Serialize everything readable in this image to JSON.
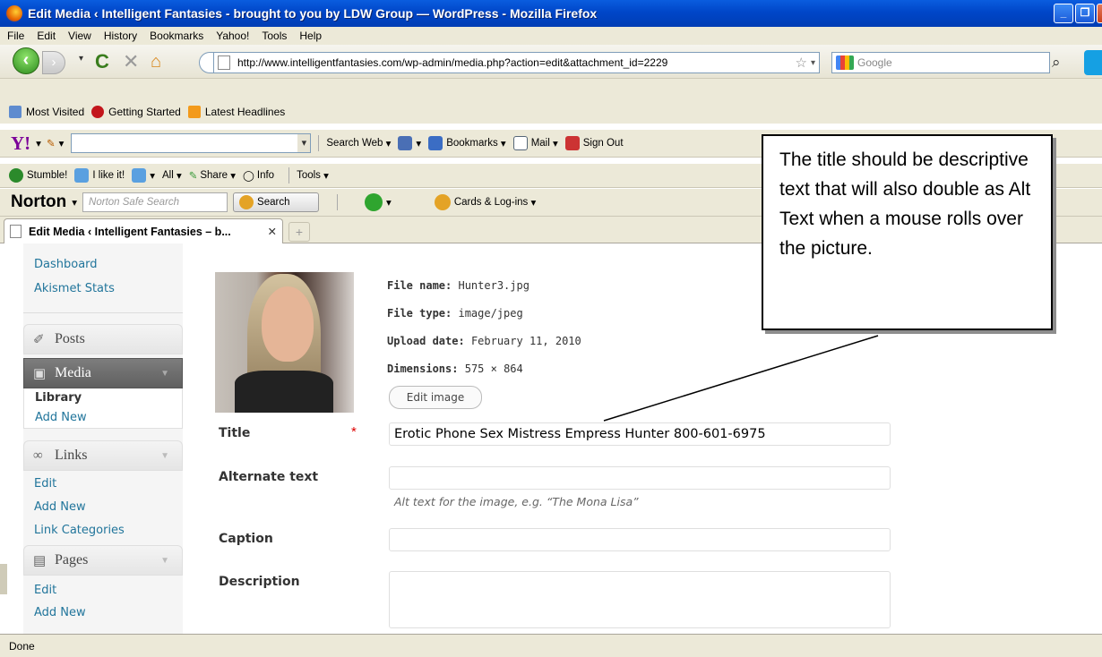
{
  "window": {
    "title": "Edit Media ‹ Intelligent Fantasies - brought to you by LDW Group — WordPress - Mozilla Firefox"
  },
  "menubar": [
    "File",
    "Edit",
    "View",
    "History",
    "Bookmarks",
    "Yahoo!",
    "Tools",
    "Help"
  ],
  "navbar": {
    "url": "http://www.intelligentfantasies.com/wp-admin/media.php?action=edit&attachment_id=2229",
    "search_placeholder": "Google"
  },
  "bookmarks": [
    "Most Visited",
    "Getting Started",
    "Latest Headlines"
  ],
  "yahoo_toolbar": {
    "logo": "Y!",
    "search_web": "Search Web",
    "bookmarks": "Bookmarks",
    "mail": "Mail",
    "sign_out": "Sign Out"
  },
  "stumble_toolbar": {
    "stumble": "Stumble!",
    "like": "I like it!",
    "all": "All",
    "share": "Share",
    "info": "Info",
    "tools": "Tools"
  },
  "norton_toolbar": {
    "logo": "Norton",
    "search_placeholder": "Norton Safe Search",
    "search_button": "Search",
    "cards": "Cards & Log-ins"
  },
  "tab": {
    "label": "Edit Media ‹ Intelligent Fantasies – b..."
  },
  "sidebar": {
    "top_links": [
      "Dashboard",
      "Akismet Stats"
    ],
    "posts": "Posts",
    "media": "Media",
    "media_items": [
      "Library",
      "Add New"
    ],
    "links": "Links",
    "links_items": [
      "Edit",
      "Add New",
      "Link Categories"
    ],
    "pages": "Pages",
    "pages_items": [
      "Edit",
      "Add New"
    ]
  },
  "file_info": {
    "name_label": "File name:",
    "name": "Hunter3.jpg",
    "type_label": "File type:",
    "type": "image/jpeg",
    "date_label": "Upload date:",
    "date": "February 11, 2010",
    "dim_label": "Dimensions:",
    "dim": "575 × 864",
    "edit_image": "Edit image"
  },
  "form": {
    "title_label": "Title",
    "required_mark": "*",
    "title_value": "Erotic Phone Sex Mistress Empress Hunter 800-601-6975",
    "alt_label": "Alternate text",
    "alt_value": "",
    "alt_help": "Alt text for the image, e.g. “The Mona Lisa”",
    "caption_label": "Caption",
    "caption_value": "",
    "description_label": "Description",
    "description_value": ""
  },
  "callout": {
    "text": "The title should be descriptive text that will also double as Alt Text when a mouse rolls over the picture."
  },
  "status": {
    "text": "Done"
  },
  "colors": {
    "titlebar": "#0054e3",
    "wp_link": "#21759b",
    "media_active": "#6d6d6d"
  }
}
